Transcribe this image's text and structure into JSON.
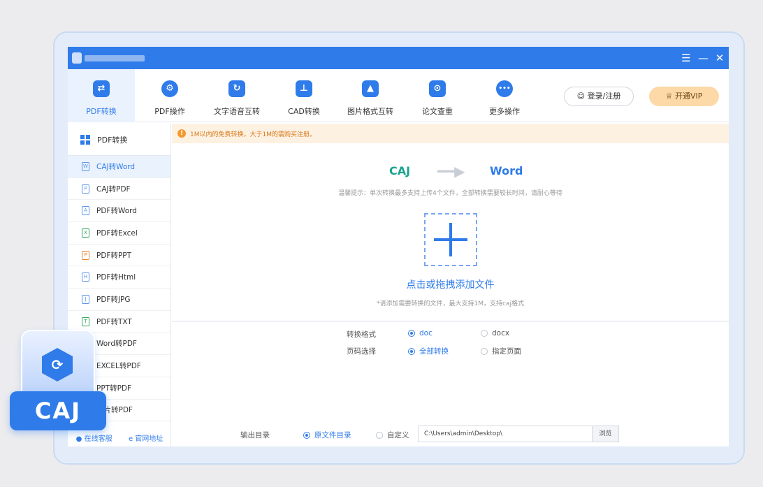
{
  "window": {
    "controls": [
      "☰",
      "—",
      "✕"
    ]
  },
  "toolbar": {
    "tools": [
      {
        "label": "PDF转换",
        "icon": "⇄"
      },
      {
        "label": "PDF操作",
        "icon": "⚙"
      },
      {
        "label": "文字语音互转",
        "icon": "↻"
      },
      {
        "label": "CAD转换",
        "icon": "⊥"
      },
      {
        "label": "图片格式互转",
        "icon": "▲"
      },
      {
        "label": "论文查重",
        "icon": "⊙"
      },
      {
        "label": "更多操作",
        "icon": "•••"
      }
    ],
    "login_label": "登录/注册",
    "vip_label": "开通VIP"
  },
  "sidebar": {
    "header": "PDF转换",
    "items": [
      {
        "label": "CAJ转Word",
        "icon": "W"
      },
      {
        "label": "CAJ转PDF",
        "icon": "P"
      },
      {
        "label": "PDF转Word",
        "icon": "A"
      },
      {
        "label": "PDF转Excel",
        "icon": "X"
      },
      {
        "label": "PDF转PPT",
        "icon": "P"
      },
      {
        "label": "PDF转Html",
        "icon": "H"
      },
      {
        "label": "PDF转JPG",
        "icon": "J"
      },
      {
        "label": "PDF转TXT",
        "icon": "T"
      },
      {
        "label": "Word转PDF",
        "icon": "W"
      },
      {
        "label": "EXCEL转PDF",
        "icon": "X"
      },
      {
        "label": "PPT转PDF",
        "icon": "P"
      },
      {
        "label": "图片转PDF",
        "icon": "I"
      }
    ],
    "footer": {
      "service": "在线客服",
      "website": "官网地址"
    }
  },
  "notice": {
    "text": "1M以内的免费转换，大于1M的需购买注册。",
    "icon": "!"
  },
  "conversion": {
    "from": "CAJ",
    "arrow": "━━▶",
    "to": "Word"
  },
  "hint": "温馨提示：单次转换最多支持上传4个文件，全部转换需要较长时间，请耐心等待",
  "dropzone": {
    "title": "点击或拖拽添加文件",
    "subtitle": "*请添加需要转换的文件，最大支持1M，支持caj格式"
  },
  "options": {
    "format": {
      "label": "转换格式",
      "choices": [
        "doc",
        "docx"
      ],
      "selected": "doc"
    },
    "pages": {
      "label": "页码选择",
      "choices": [
        "全部转换",
        "指定页面"
      ],
      "selected": "全部转换"
    }
  },
  "output": {
    "label": "输出目录",
    "choices": [
      "原文件目录",
      "自定义"
    ],
    "selected": "原文件目录",
    "path": "C:\\Users\\admin\\Desktop\\",
    "browse_label": "浏览"
  },
  "badge": {
    "text": "CAJ",
    "icon": "⟳"
  }
}
